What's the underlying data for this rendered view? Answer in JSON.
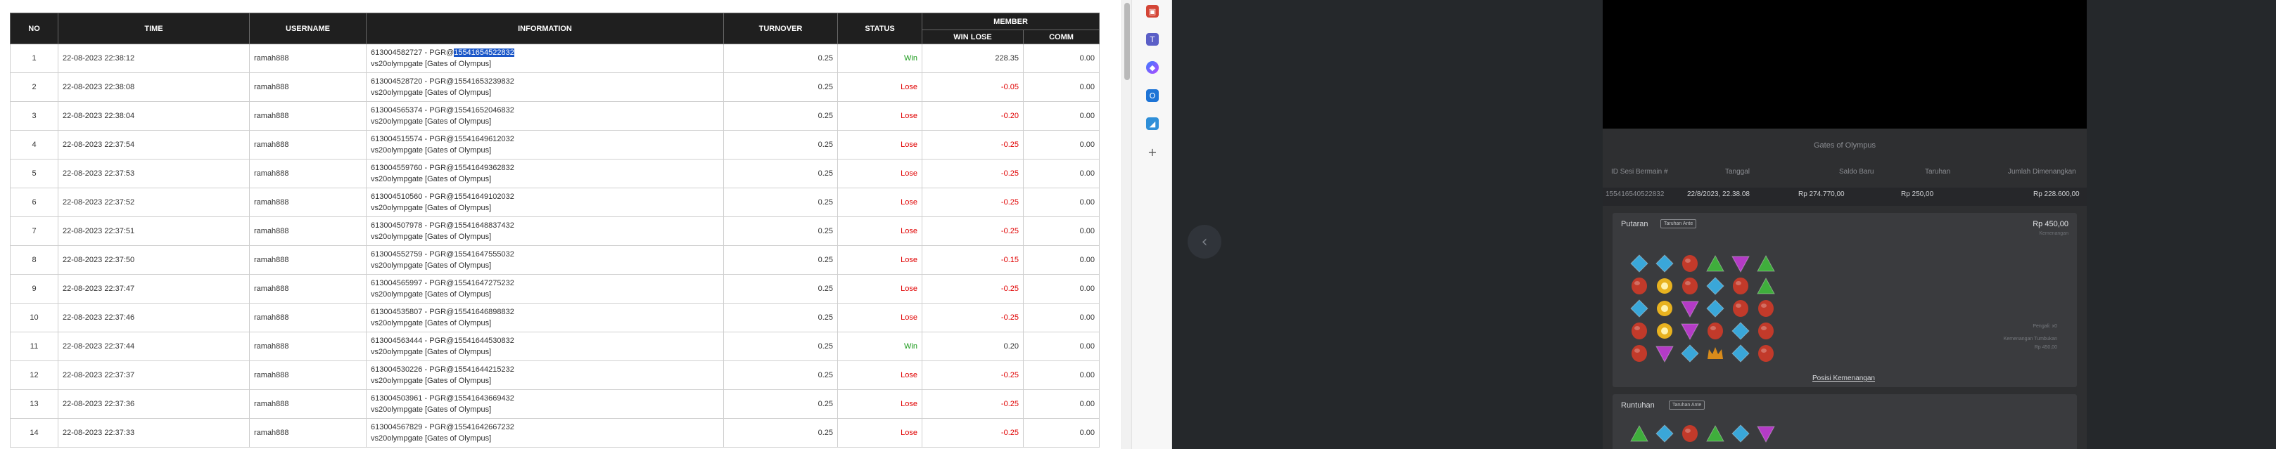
{
  "table": {
    "headers": {
      "no": "NO",
      "time": "TIME",
      "username": "USERNAME",
      "information": "INFORMATION",
      "turnover": "TURNOVER",
      "status": "STATUS",
      "member": "MEMBER",
      "win_lose": "WIN LOSE",
      "comm": "COMM"
    },
    "rows": [
      {
        "no": "1",
        "time": "22-08-2023 22:38:12",
        "username": "ramah888",
        "info_prefix": "613004582727 - PGR@",
        "info_code": "15541654522832",
        "info_line2": "vs20olympgate [Gates of Olympus]",
        "turnover": "0.25",
        "status": "Win",
        "win_lose": "228.35",
        "comm": "0.00"
      },
      {
        "no": "2",
        "time": "22-08-2023 22:38:08",
        "username": "ramah888",
        "info_prefix": "613004528720 - PGR@",
        "info_code": "15541653239832",
        "info_line2": "vs20olympgate [Gates of Olympus]",
        "turnover": "0.25",
        "status": "Lose",
        "win_lose": "-0.05",
        "comm": "0.00"
      },
      {
        "no": "3",
        "time": "22-08-2023 22:38:04",
        "username": "ramah888",
        "info_prefix": "613004565374 - PGR@",
        "info_code": "15541652046832",
        "info_line2": "vs20olympgate [Gates of Olympus]",
        "turnover": "0.25",
        "status": "Lose",
        "win_lose": "-0.20",
        "comm": "0.00"
      },
      {
        "no": "4",
        "time": "22-08-2023 22:37:54",
        "username": "ramah888",
        "info_prefix": "613004515574 - PGR@",
        "info_code": "15541649612032",
        "info_line2": "vs20olympgate [Gates of Olympus]",
        "turnover": "0.25",
        "status": "Lose",
        "win_lose": "-0.25",
        "comm": "0.00"
      },
      {
        "no": "5",
        "time": "22-08-2023 22:37:53",
        "username": "ramah888",
        "info_prefix": "613004559760 - PGR@",
        "info_code": "15541649362832",
        "info_line2": "vs20olympgate [Gates of Olympus]",
        "turnover": "0.25",
        "status": "Lose",
        "win_lose": "-0.25",
        "comm": "0.00"
      },
      {
        "no": "6",
        "time": "22-08-2023 22:37:52",
        "username": "ramah888",
        "info_prefix": "613004510560 - PGR@",
        "info_code": "15541649102032",
        "info_line2": "vs20olympgate [Gates of Olympus]",
        "turnover": "0.25",
        "status": "Lose",
        "win_lose": "-0.25",
        "comm": "0.00"
      },
      {
        "no": "7",
        "time": "22-08-2023 22:37:51",
        "username": "ramah888",
        "info_prefix": "613004507978 - PGR@",
        "info_code": "15541648837432",
        "info_line2": "vs20olympgate [Gates of Olympus]",
        "turnover": "0.25",
        "status": "Lose",
        "win_lose": "-0.25",
        "comm": "0.00"
      },
      {
        "no": "8",
        "time": "22-08-2023 22:37:50",
        "username": "ramah888",
        "info_prefix": "613004552759 - PGR@",
        "info_code": "15541647555032",
        "info_line2": "vs20olympgate [Gates of Olympus]",
        "turnover": "0.25",
        "status": "Lose",
        "win_lose": "-0.15",
        "comm": "0.00"
      },
      {
        "no": "9",
        "time": "22-08-2023 22:37:47",
        "username": "ramah888",
        "info_prefix": "613004565997 - PGR@",
        "info_code": "15541647275232",
        "info_line2": "vs20olympgate [Gates of Olympus]",
        "turnover": "0.25",
        "status": "Lose",
        "win_lose": "-0.25",
        "comm": "0.00"
      },
      {
        "no": "10",
        "time": "22-08-2023 22:37:46",
        "username": "ramah888",
        "info_prefix": "613004535807 - PGR@",
        "info_code": "15541646898832",
        "info_line2": "vs20olympgate [Gates of Olympus]",
        "turnover": "0.25",
        "status": "Lose",
        "win_lose": "-0.25",
        "comm": "0.00"
      },
      {
        "no": "11",
        "time": "22-08-2023 22:37:44",
        "username": "ramah888",
        "info_prefix": "613004563444 - PGR@",
        "info_code": "15541644530832",
        "info_line2": "vs20olympgate [Gates of Olympus]",
        "turnover": "0.25",
        "status": "Win",
        "win_lose": "0.20",
        "comm": "0.00"
      },
      {
        "no": "12",
        "time": "22-08-2023 22:37:37",
        "username": "ramah888",
        "info_prefix": "613004530226 - PGR@",
        "info_code": "15541644215232",
        "info_line2": "vs20olympgate [Gates of Olympus]",
        "turnover": "0.25",
        "status": "Lose",
        "win_lose": "-0.25",
        "comm": "0.00"
      },
      {
        "no": "13",
        "time": "22-08-2023 22:37:36",
        "username": "ramah888",
        "info_prefix": "613004503961 - PGR@",
        "info_code": "15541643669432",
        "info_line2": "vs20olympgate [Gates of Olympus]",
        "turnover": "0.25",
        "status": "Lose",
        "win_lose": "-0.25",
        "comm": "0.00"
      },
      {
        "no": "14",
        "time": "22-08-2023 22:37:33",
        "username": "ramah888",
        "info_prefix": "613004567829 - PGR@",
        "info_code": "15541642667232",
        "info_line2": "vs20olympgate [Gates of Olympus]",
        "turnover": "0.25",
        "status": "Lose",
        "win_lose": "-0.25",
        "comm": "0.00"
      }
    ]
  },
  "sidebar_icons": [
    "gift-icon",
    "teams-icon",
    "copilot-icon",
    "outlook-icon",
    "shopping-icon",
    "add-icon"
  ],
  "viewer": {
    "nav_prev_glyph": "‹",
    "game_title": "Gates of Olympus",
    "headers": [
      "ID Sesi Bermain #",
      "Tanggal",
      "Saldo Baru",
      "Taruhan",
      "Jumlah Dimenangkan"
    ],
    "values": [
      "155416540522832",
      "22/8/2023, 22.38.08",
      "Rp 274.770,00",
      "Rp 250,00",
      "Rp 228.600,00"
    ],
    "spin_card": {
      "label": "Putaran",
      "tag": "Taruhan Ante",
      "amount": "Rp 450,00",
      "sub": "Kemenangan",
      "notes": [
        "Pengali: x0",
        "Kemenangan Tumbukan",
        "Rp 450,00"
      ],
      "link": "Posisi Kemenangan"
    },
    "tumble_card": {
      "label": "Runtuhan",
      "tag": "Taruhan Ante"
    },
    "gem_grid": [
      [
        "blue",
        "blue",
        "red",
        "green",
        "purple",
        "green"
      ],
      [
        "red",
        "yellow",
        "red",
        "blue",
        "red",
        "green"
      ],
      [
        "blue",
        "yellow",
        "purple",
        "blue",
        "red",
        "red"
      ],
      [
        "red",
        "yellow",
        "purple",
        "red",
        "blue",
        "red"
      ],
      [
        "red",
        "purple",
        "blue",
        "crown",
        "blue",
        "red"
      ]
    ],
    "tumble_row": [
      "green",
      "blue",
      "red",
      "green",
      "blue",
      "purple"
    ],
    "colors": {
      "blue": "#3aa7d9",
      "red": "#c23a2a",
      "green": "#3fae3c",
      "purple": "#b43bc6",
      "yellow": "#e8b21f",
      "crown": "#d98b1a"
    }
  }
}
